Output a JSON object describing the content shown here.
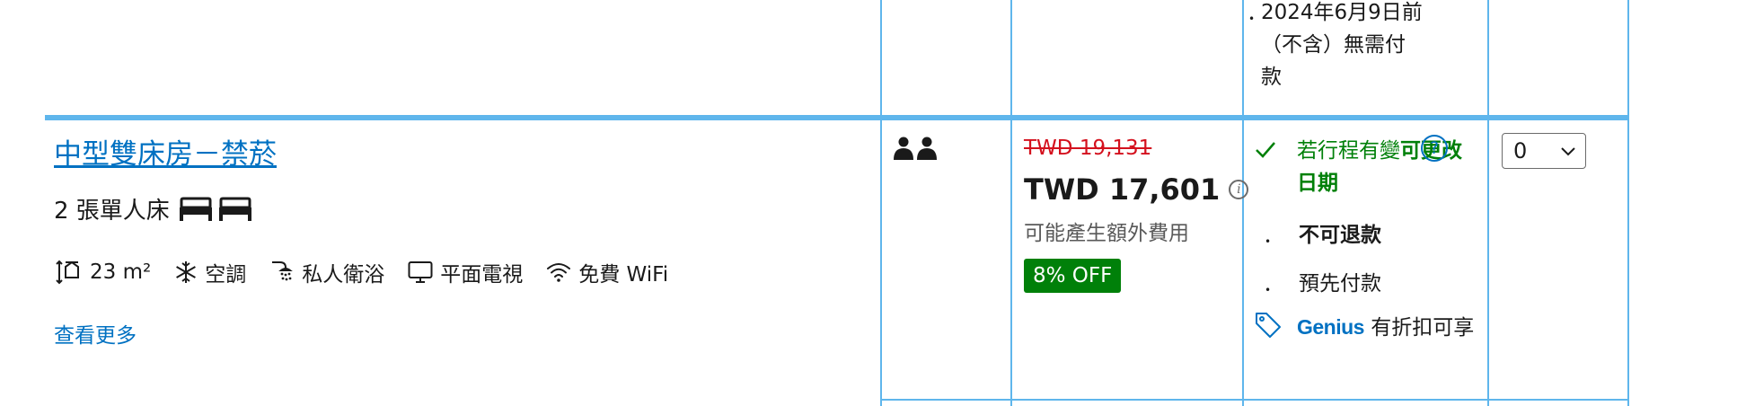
{
  "previous_row": {
    "conditions_text": "2024年6月9日前（不含）無需付款"
  },
  "room": {
    "title": "中型雙床房－禁菸",
    "bed_text": "2 張單人床",
    "amenities": [
      {
        "icon": "room-size-icon",
        "label": "23 m²"
      },
      {
        "icon": "snowflake-icon",
        "label": "空調"
      },
      {
        "icon": "shower-icon",
        "label": "私人衛浴"
      },
      {
        "icon": "tv-icon",
        "label": "平面電視"
      },
      {
        "icon": "wifi-icon",
        "label": "免費 WiFi"
      }
    ],
    "see_more": "查看更多"
  },
  "occupancy": {
    "icon": "two-persons-icon",
    "guests": 2
  },
  "price": {
    "original": "TWD 19,131",
    "current": "TWD 17,601",
    "extra_fees": "可能產生額外費用",
    "discount_badge": "8% OFF"
  },
  "conditions": {
    "change_prefix": "若行程有變",
    "change_bold": "可更改日期",
    "non_refundable": "不可退款",
    "prepay": "預先付款",
    "genius_brand": "Genius",
    "genius_text": "有折扣可享"
  },
  "select": {
    "value": "0"
  },
  "colors": {
    "link": "#0071c2",
    "border": "#5fb6ec",
    "strike_price": "#d4111e",
    "green": "#008009"
  }
}
